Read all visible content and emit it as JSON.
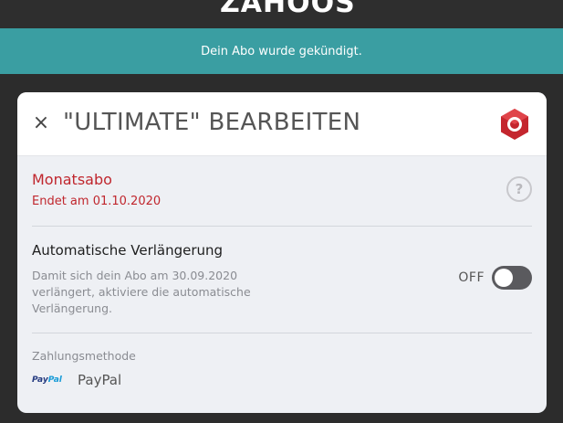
{
  "header": {
    "logo_text": "ZAHOOS"
  },
  "notice": {
    "text": "Dein Abo wurde gekündigt."
  },
  "modal": {
    "close_glyph": "×",
    "title": "\"ULTIMATE\" BEARBEITEN",
    "badge_icon": "ultimate-gem-icon",
    "plan": {
      "name": "Monatsabo",
      "end": "Endet am 01.10.2020",
      "help_glyph": "?"
    },
    "renewal": {
      "title": "Automatische Verlängerung",
      "description": "Damit sich dein Abo am 30.09.2020 verlängert, aktiviere die automatische Verlängerung.",
      "toggle_label": "OFF",
      "enabled": false
    },
    "payment": {
      "label": "Zahlungsmethode",
      "logo_pay": "Pay",
      "logo_pal": "Pal",
      "method": "PayPal"
    }
  },
  "colors": {
    "notice_bg": "#3a9ea2",
    "accent_red": "#c0262d",
    "toggle_off": "#5a5a5e"
  }
}
